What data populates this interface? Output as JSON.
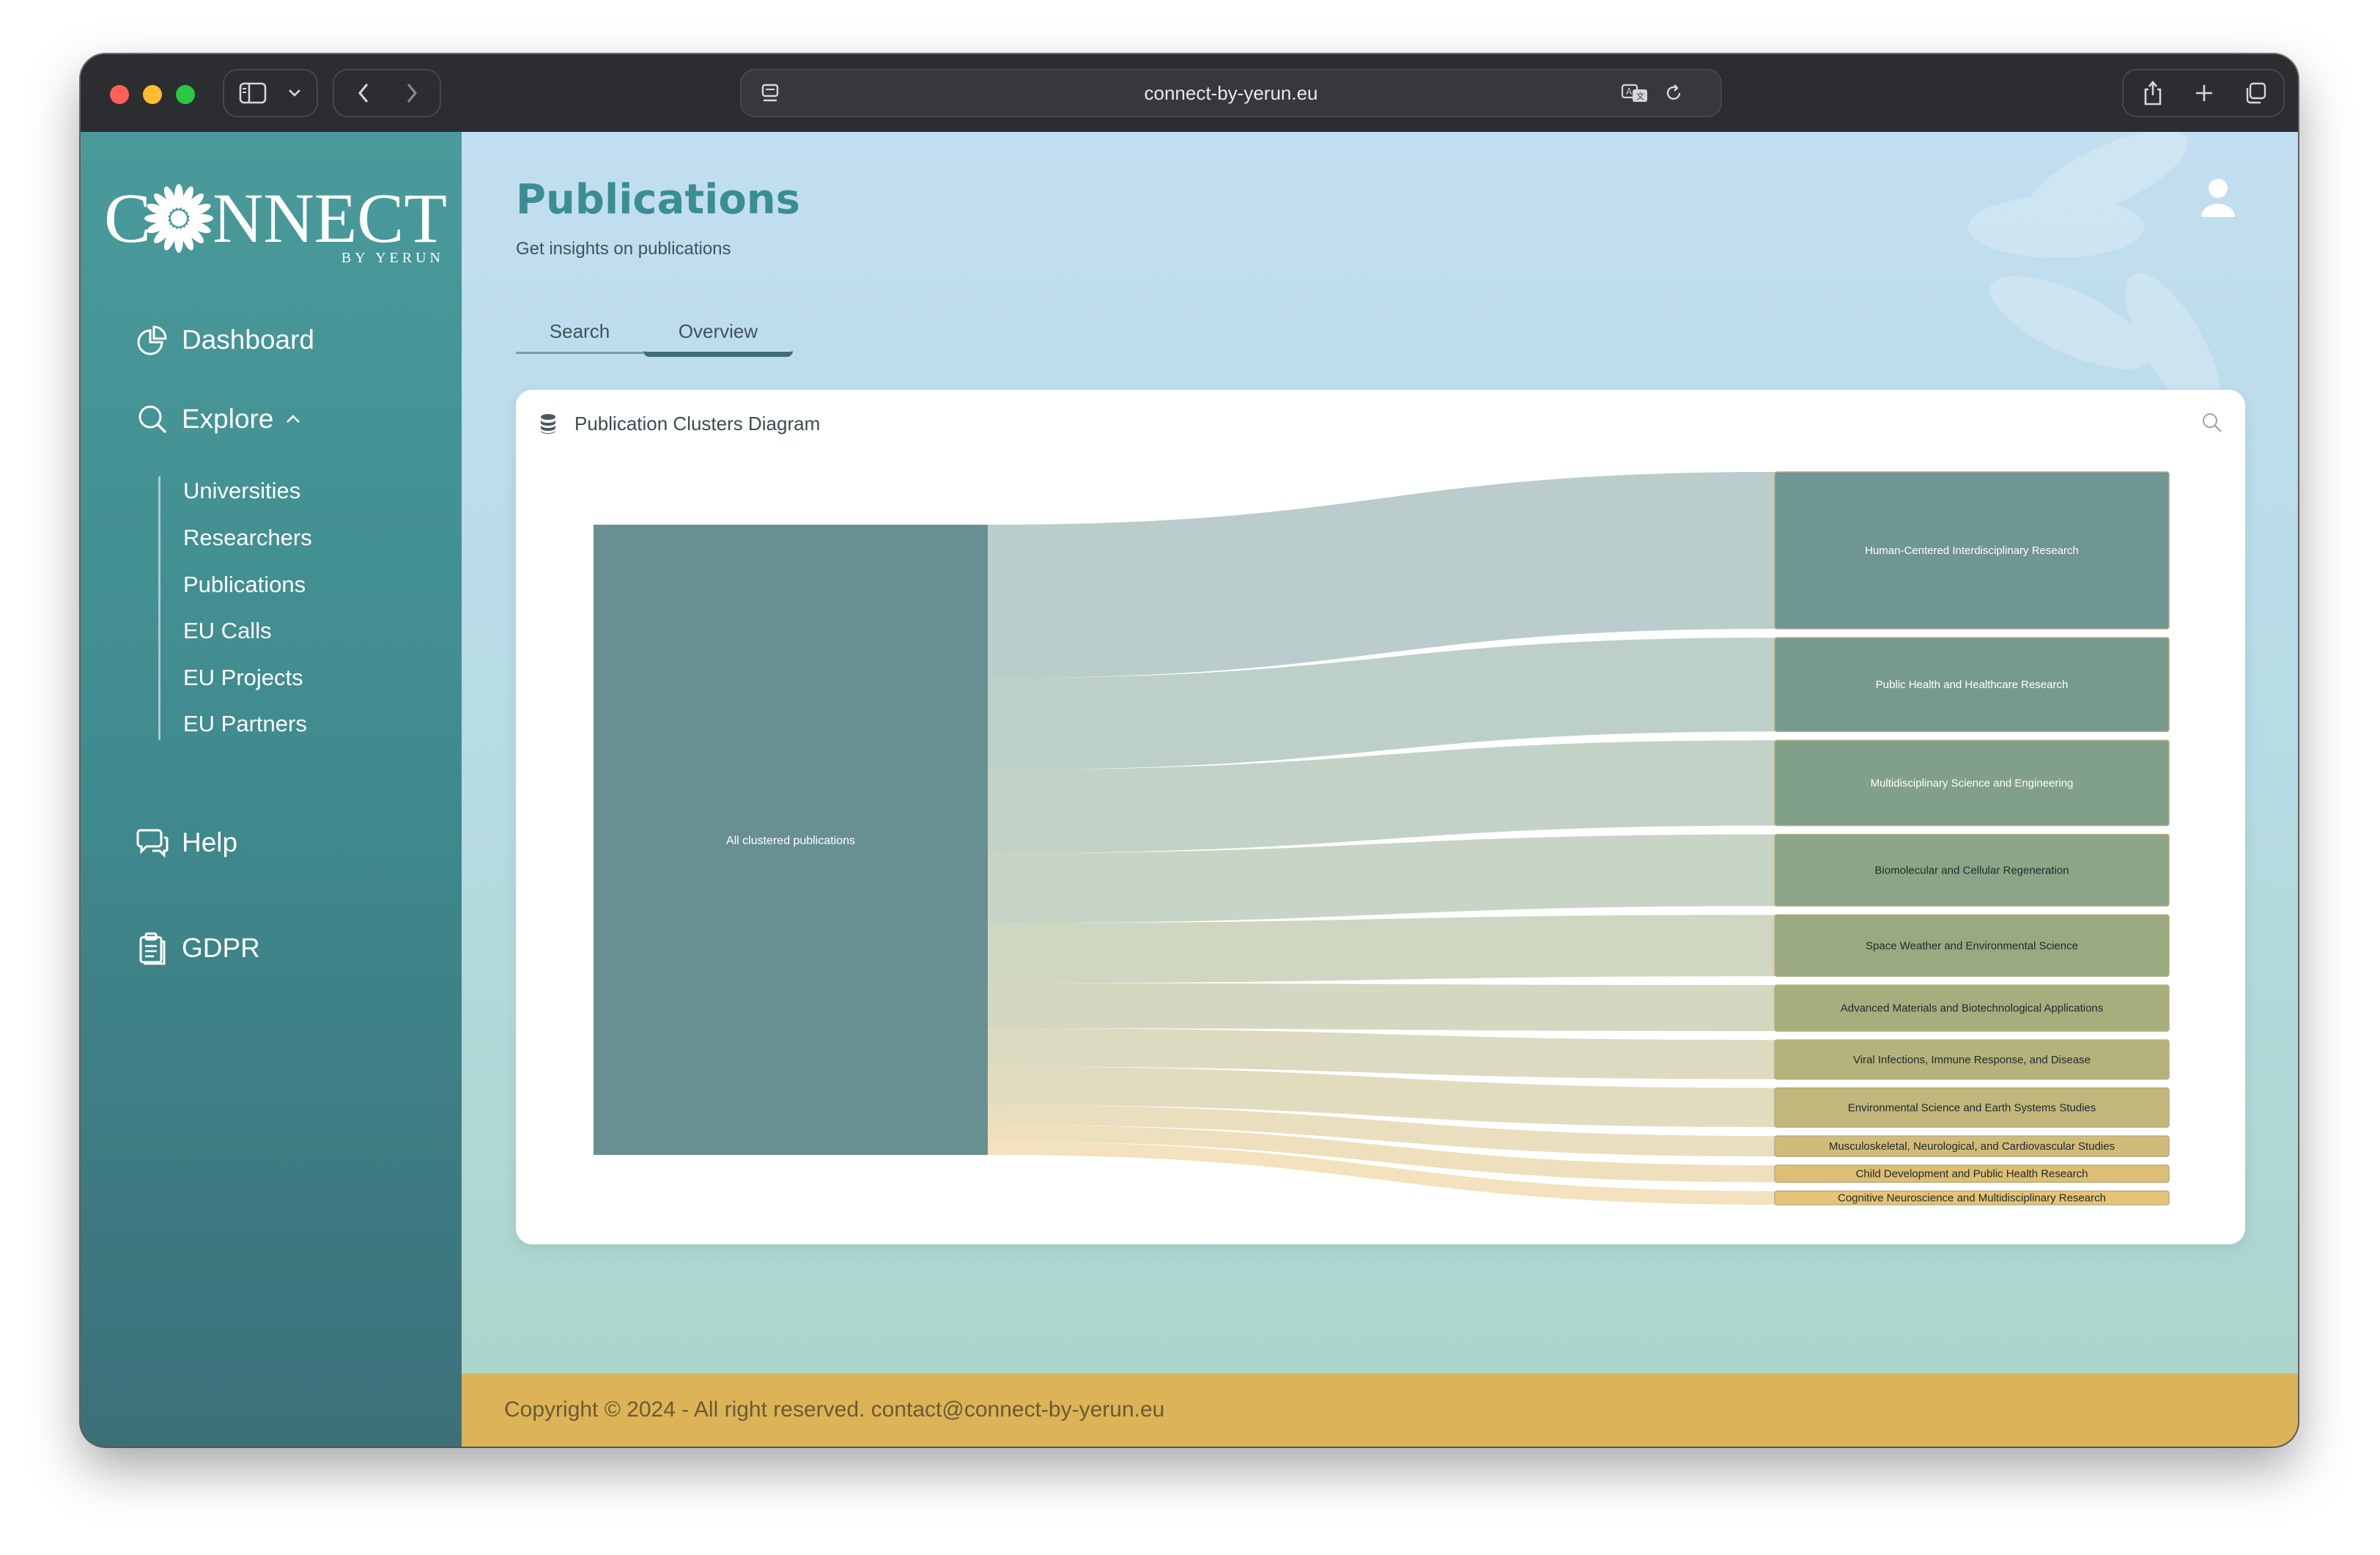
{
  "browser": {
    "url": "connect-by-yerun.eu"
  },
  "sidebar": {
    "logo_text": "C NNECT",
    "logo_left": "C",
    "logo_right": "NNECT",
    "logo_tagline": "BY YERUN",
    "items": [
      {
        "label": "Dashboard",
        "icon": "pie-chart-icon"
      },
      {
        "label": "Explore",
        "icon": "search-icon",
        "expanded": true
      },
      {
        "label": "Help",
        "icon": "chat-icon"
      },
      {
        "label": "GDPR",
        "icon": "clipboard-icon"
      }
    ],
    "explore_sub": [
      "Universities",
      "Researchers",
      "Publications",
      "EU Calls",
      "EU Projects",
      "EU Partners"
    ]
  },
  "header": {
    "title": "Publications",
    "subtitle": "Get insights on publications"
  },
  "tabs": [
    {
      "label": "Search",
      "active": false
    },
    {
      "label": "Overview",
      "active": true
    }
  ],
  "card": {
    "title": "Publication Clusters Diagram"
  },
  "chart_data": {
    "type": "sankey",
    "source": "All clustered publications",
    "targets": [
      {
        "name": "Human-Centered Interdisciplinary Research",
        "value": 92,
        "color": "#6f9594"
      },
      {
        "name": "Public Health and Healthcare Research",
        "value": 55,
        "color": "#769a8e"
      },
      {
        "name": "Multidisciplinary Science and Engineering",
        "value": 50,
        "color": "#80a08a"
      },
      {
        "name": "Biomolecular and Cellular Regeneration",
        "value": 42,
        "color": "#8ca586"
      },
      {
        "name": "Space Weather and Environmental Science",
        "value": 36,
        "color": "#9aa980"
      },
      {
        "name": "Advanced Materials and Biotechnological Applications",
        "value": 27,
        "color": "#a8ad7e"
      },
      {
        "name": "Viral Infections, Immune Response, and Disease",
        "value": 23,
        "color": "#b5b27b"
      },
      {
        "name": "Environmental Science and Earth Systems Studies",
        "value": 23,
        "color": "#c2b67a"
      },
      {
        "name": "Musculoskeletal, Neurological, and Cardiovascular Studies",
        "value": 12,
        "color": "#d1bb78"
      },
      {
        "name": "Child Development and Public Health Research",
        "value": 10,
        "color": "#dcbe74"
      },
      {
        "name": "Cognitive Neuroscience and Multidisciplinary Research",
        "value": 8,
        "color": "#e6c375"
      }
    ],
    "source_color": "#688f91"
  },
  "footer": {
    "text": "Copyright © 2024 - All right reserved. contact@connect-by-yerun.eu"
  }
}
